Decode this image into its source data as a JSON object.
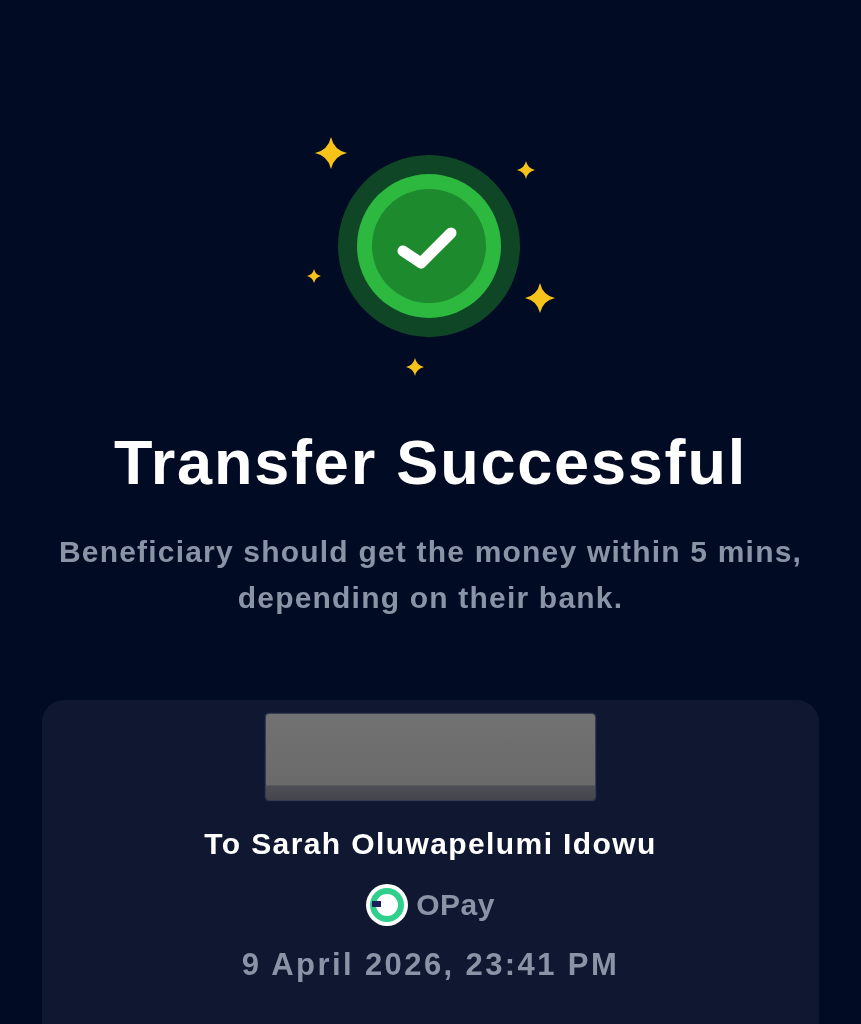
{
  "status": {
    "title": "Transfer Successful",
    "message": "Beneficiary should get the money within 5 mins, depending on their bank."
  },
  "receipt": {
    "recipient": "To Sarah Oluwapelumi Idowu",
    "bank": "OPay",
    "date": "9 April 2026, 23:41 PM"
  }
}
